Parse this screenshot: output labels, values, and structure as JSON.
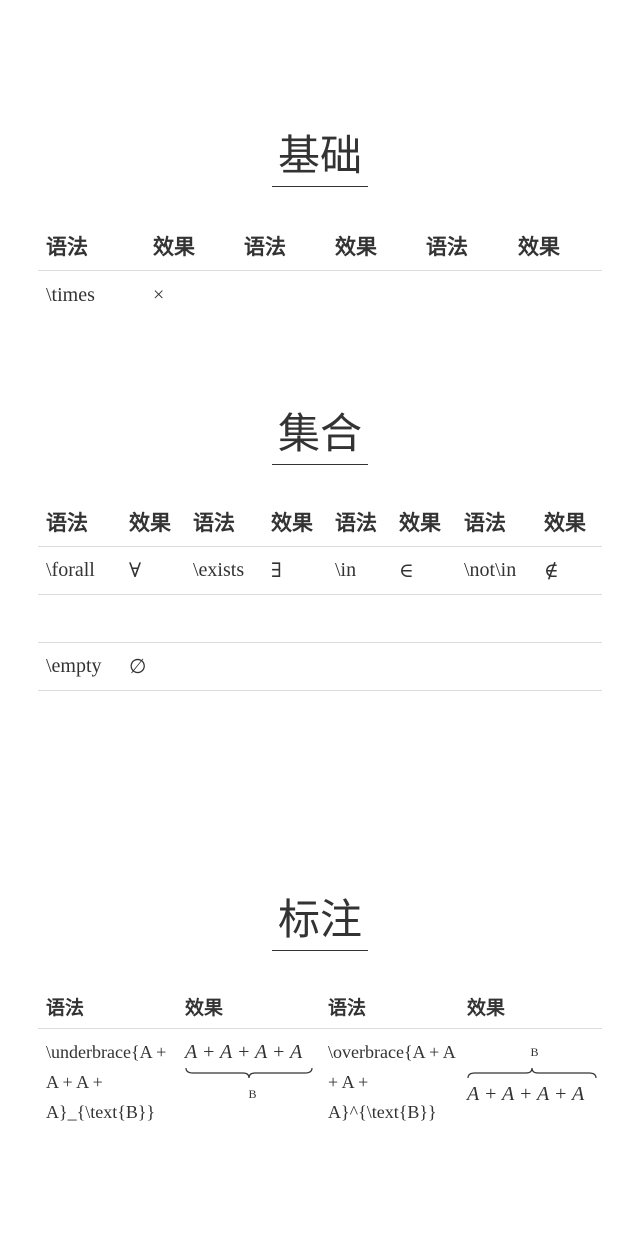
{
  "sections": [
    {
      "title": "基础"
    },
    {
      "title": "集合"
    },
    {
      "title": "标注"
    }
  ],
  "basic": {
    "headers": [
      "语法",
      "效果",
      "语法",
      "效果",
      "语法",
      "效果"
    ],
    "rows": [
      [
        "\\times",
        "×",
        "",
        "",
        "",
        ""
      ]
    ]
  },
  "sets": {
    "headers": [
      "语法",
      "效果",
      "语法",
      "效果",
      "语法",
      "效果",
      "语法",
      "效果"
    ],
    "rows": [
      [
        "\\forall",
        "∀",
        "\\exists",
        "∃",
        "\\in",
        "∈",
        "\\not\\in",
        "∉"
      ],
      [
        "",
        "",
        "",
        "",
        "",
        "",
        "",
        ""
      ],
      [
        "\\empty",
        "∅",
        "",
        "",
        "",
        "",
        "",
        ""
      ]
    ]
  },
  "notes": {
    "headers": [
      "语法",
      "效果",
      "语法",
      "效果"
    ],
    "underbrace_syntax": "\\underbrace{A + A + A + A}_{\\text{B}}",
    "underbrace_expr": "A + A + A + A",
    "underbrace_label": "B",
    "overbrace_syntax": "\\overbrace{A + A + A + A}^{\\text{B}}",
    "overbrace_expr": "A + A + A + A",
    "overbrace_label": "B"
  }
}
